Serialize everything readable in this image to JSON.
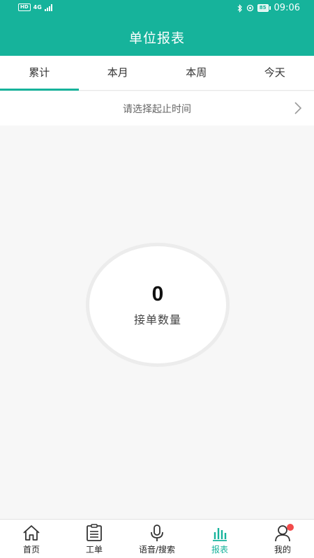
{
  "status_bar": {
    "hd": "HD",
    "network": "4G",
    "battery": "85",
    "time": "09:06",
    "icons": [
      "signal-icon",
      "bluetooth-icon",
      "location-icon",
      "battery-icon"
    ]
  },
  "header": {
    "title": "单位报表"
  },
  "tabs": [
    {
      "label": "累计",
      "active": true
    },
    {
      "label": "本月",
      "active": false
    },
    {
      "label": "本周",
      "active": false
    },
    {
      "label": "今天",
      "active": false
    }
  ],
  "date_picker": {
    "label": "请选择起止时间",
    "icon": "chevron-right-icon"
  },
  "stat": {
    "value": "0",
    "label": "接单数量"
  },
  "bottom_nav": [
    {
      "label": "首页",
      "icon": "home-icon",
      "active": false
    },
    {
      "label": "工单",
      "icon": "clipboard-icon",
      "active": false
    },
    {
      "label": "语音/搜索",
      "icon": "microphone-icon",
      "active": false
    },
    {
      "label": "报表",
      "icon": "bar-chart-icon",
      "active": true
    },
    {
      "label": "我的",
      "icon": "user-icon",
      "active": false,
      "notification_dot": true
    }
  ],
  "colors": {
    "primary": "#16b39b",
    "background": "#f7f7f7",
    "badge": "#f24b4b",
    "circle_border": "#ececec"
  }
}
